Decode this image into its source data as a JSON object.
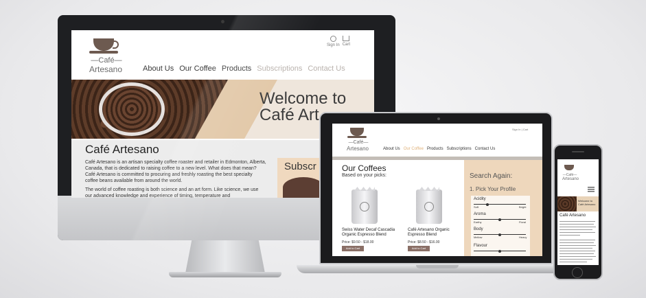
{
  "brand": {
    "logo_top": "—Café—",
    "logo_bottom": "Artesano"
  },
  "desktop": {
    "nav": [
      "About Us",
      "Our Coffee",
      "Products",
      "Subscriptions",
      "Contact Us"
    ],
    "util": {
      "sign_in": "Sign In",
      "cart": "Cart"
    },
    "hero_title_line1": "Welcome to",
    "hero_title_line2": "Café Art",
    "intro_heading": "Café Artesano",
    "intro_p1": "Café Artesano is an artisan specialty coffee roaster and retailer in Edmonton, Alberta, Canada, that is dedicated to raising coffee to a new level. What does that mean? Café Artesano is committed to procuring and freshly roasting the best specialty coffee beans available from around the world.",
    "intro_p2": "The world of coffee roasting is both science and an art form. Like science, we use our advanced knowledge and experience of timing, temperature and",
    "subscribe_label": "Subscr"
  },
  "laptop": {
    "nav": [
      "About Us",
      "Our Coffee",
      "Products",
      "Subscriptions",
      "Contact Us"
    ],
    "util": {
      "sign_in": "Sign In",
      "cart": "Cart"
    },
    "heading": "Our Coffees",
    "subheading": "Based on your picks:",
    "products": [
      {
        "name": "Swiss Water Decaf Cascadia Organic Espresso Blend",
        "price": "Price: $9.50 - $18.00",
        "button": "Add to Cart"
      },
      {
        "name": "Café Artesano Organic Espresso Blend",
        "price": "Price: $8.50 - $16.00",
        "button": "Add to Cart"
      }
    ],
    "sidebar": {
      "title": "Search Again:",
      "step": "1. Pick Your Profile",
      "profiles": [
        {
          "label": "Acidity",
          "low": "Soft",
          "high": "Bright",
          "level": 2
        },
        {
          "label": "Aroma",
          "low": "Earthy",
          "high": "Floral",
          "level": 3
        },
        {
          "label": "Body",
          "low": "Mellow",
          "high": "Heavy",
          "level": 3
        },
        {
          "label": "Flavour",
          "low": "",
          "high": "",
          "level": 3
        }
      ]
    }
  },
  "phone": {
    "hero_text_line1": "Welcome to",
    "hero_text_line2": "Café Artesano",
    "heading": "Café Artesano"
  }
}
